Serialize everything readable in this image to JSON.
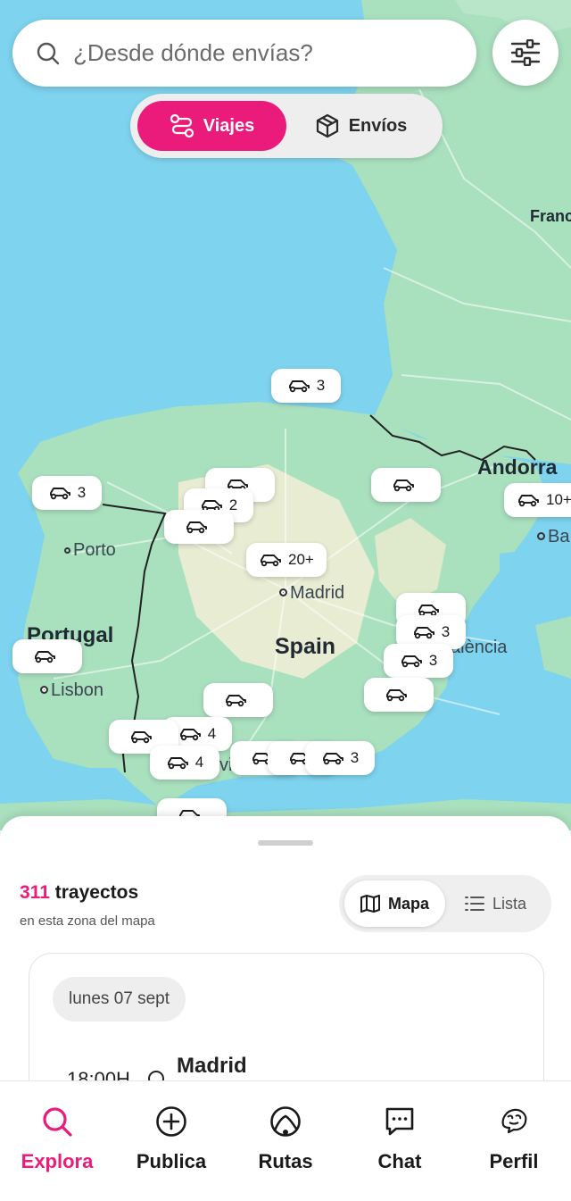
{
  "search": {
    "placeholder": "¿Desde dónde envías?"
  },
  "mode_toggle": {
    "options": [
      {
        "label": "Viajes",
        "active": true
      },
      {
        "label": "Envíos",
        "active": false
      }
    ]
  },
  "colors": {
    "accent": "#ea1b7a",
    "sea": "#7ed3ee",
    "land": "#a9e0be"
  },
  "map": {
    "places": {
      "france": "Franc",
      "andorra": "Andorra",
      "ba": "Ba",
      "porto": "Porto",
      "madrid": "Madrid",
      "portugal": "Portugal",
      "spain": "Spain",
      "valencia": "alència",
      "lisbon": "Lisbon",
      "sevilla_frag": "vil"
    },
    "pins": [
      {
        "count": "3"
      },
      {
        "count": "3"
      },
      {
        "count": ""
      },
      {
        "count": "2"
      },
      {
        "count": ""
      },
      {
        "count": ""
      },
      {
        "count": "10+"
      },
      {
        "count": "20+"
      },
      {
        "count": ""
      },
      {
        "count": "3"
      },
      {
        "count": "3"
      },
      {
        "count": ""
      },
      {
        "count": ""
      },
      {
        "count": ""
      },
      {
        "count": "4"
      },
      {
        "count": ""
      },
      {
        "count": "4"
      },
      {
        "count": ""
      },
      {
        "count": ""
      },
      {
        "count": "3"
      },
      {
        "count": ""
      }
    ]
  },
  "sheet": {
    "count_number": "311",
    "count_label": "trayectos",
    "count_sub": "en esta zona del mapa",
    "view_toggle": [
      {
        "label": "Mapa",
        "active": true
      },
      {
        "label": "Lista",
        "active": false
      }
    ],
    "card": {
      "date": "lunes 07 sept",
      "time": "18:00H",
      "city": "Madrid"
    }
  },
  "nav": [
    {
      "label": "Explora",
      "icon": "search-icon",
      "active": true
    },
    {
      "label": "Publica",
      "icon": "plus-circle-icon",
      "active": false
    },
    {
      "label": "Rutas",
      "icon": "route-icon",
      "active": false
    },
    {
      "label": "Chat",
      "icon": "chat-icon",
      "active": false
    },
    {
      "label": "Perfil",
      "icon": "avatar-icon",
      "active": false
    }
  ]
}
